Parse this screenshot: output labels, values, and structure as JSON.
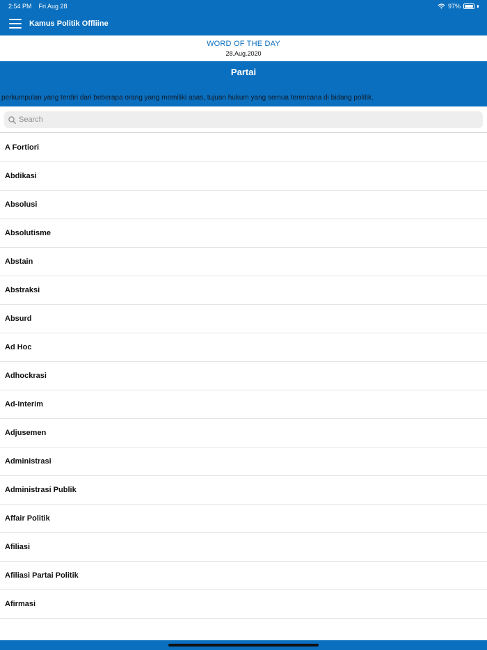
{
  "status": {
    "time": "2:54 PM",
    "date": "Fri Aug 28",
    "battery": "97%",
    "battery_level": 0.97,
    "wifi_icon": "wifi-icon",
    "battery_icon": "battery-icon"
  },
  "navbar": {
    "title": "Kamus Politik Offliine",
    "menu_icon": "hamburger-menu-icon"
  },
  "word_of_the_day": {
    "heading": "WORD OF THE DAY",
    "date": "28.Aug.2020",
    "word": "Partai",
    "definition": "perkumpulan yang terdiri dari beberapa orang yang memiliki asas, tujuan hukum yang semua terencana di bidang politik."
  },
  "search": {
    "placeholder": "Search",
    "value": "",
    "icon": "search-icon"
  },
  "terms": [
    "A Fortiori",
    "Abdikasi",
    "Absolusi",
    "Absolutisme",
    "Abstain",
    "Abstraksi",
    "Absurd",
    "Ad Hoc",
    "Adhockrasi",
    "Ad-Interim",
    "Adjusemen",
    "Administrasi",
    "Administrasi Publik",
    "Affair Politik",
    "Afiliasi",
    "Afiliasi Partai Politik",
    "Afirmasi"
  ],
  "colors": {
    "primary": "#0a6fbf",
    "background": "#ffffff",
    "search_bg": "#eeeeef",
    "divider": "#e4e4e4"
  }
}
